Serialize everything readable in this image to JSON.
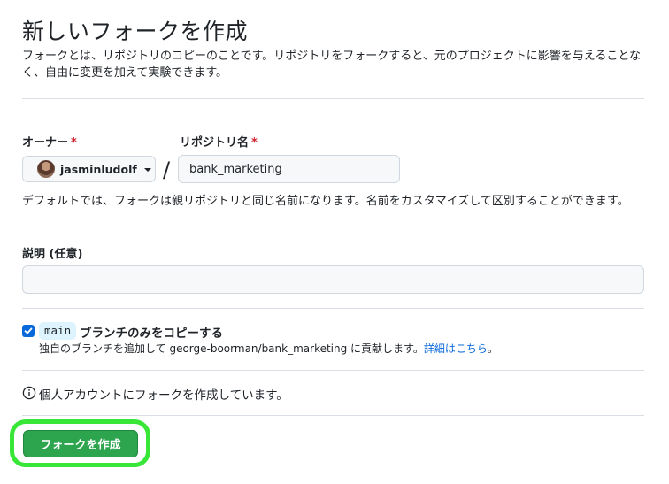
{
  "page": {
    "title": "新しいフォークを作成",
    "intro": "フォークとは、リポジトリのコピーのことです。リポジトリをフォークすると、元のプロジェクトに影響を与えることなく、自由に変更を加えて実験できます。"
  },
  "owner": {
    "label": "オーナー",
    "required_mark": "*",
    "selected": "jasminludolf"
  },
  "repository": {
    "label": "リポジトリ名",
    "required_mark": "*",
    "separator": "/",
    "value": "bank_marketing",
    "help": "デフォルトでは、フォークは親リポジトリと同じ名前になります。名前をカスタマイズして区別することができます。"
  },
  "description": {
    "label": "説明 (任意)",
    "value": ""
  },
  "copy_branch": {
    "checked": true,
    "branch": "main",
    "label": "ブランチのみをコピーする",
    "help_text": "独自のブランチを追加して george-boorman/bank_marketing に貢献します。",
    "link_text": "詳細はこちら",
    "link_suffix": "。"
  },
  "account_note": "個人アカウントにフォークを作成しています。",
  "create_button_label": "フォークを作成",
  "colors": {
    "primary_button": "#2da44e",
    "highlight_ring": "#38e638",
    "link": "#0969da",
    "required": "#cf222e"
  }
}
